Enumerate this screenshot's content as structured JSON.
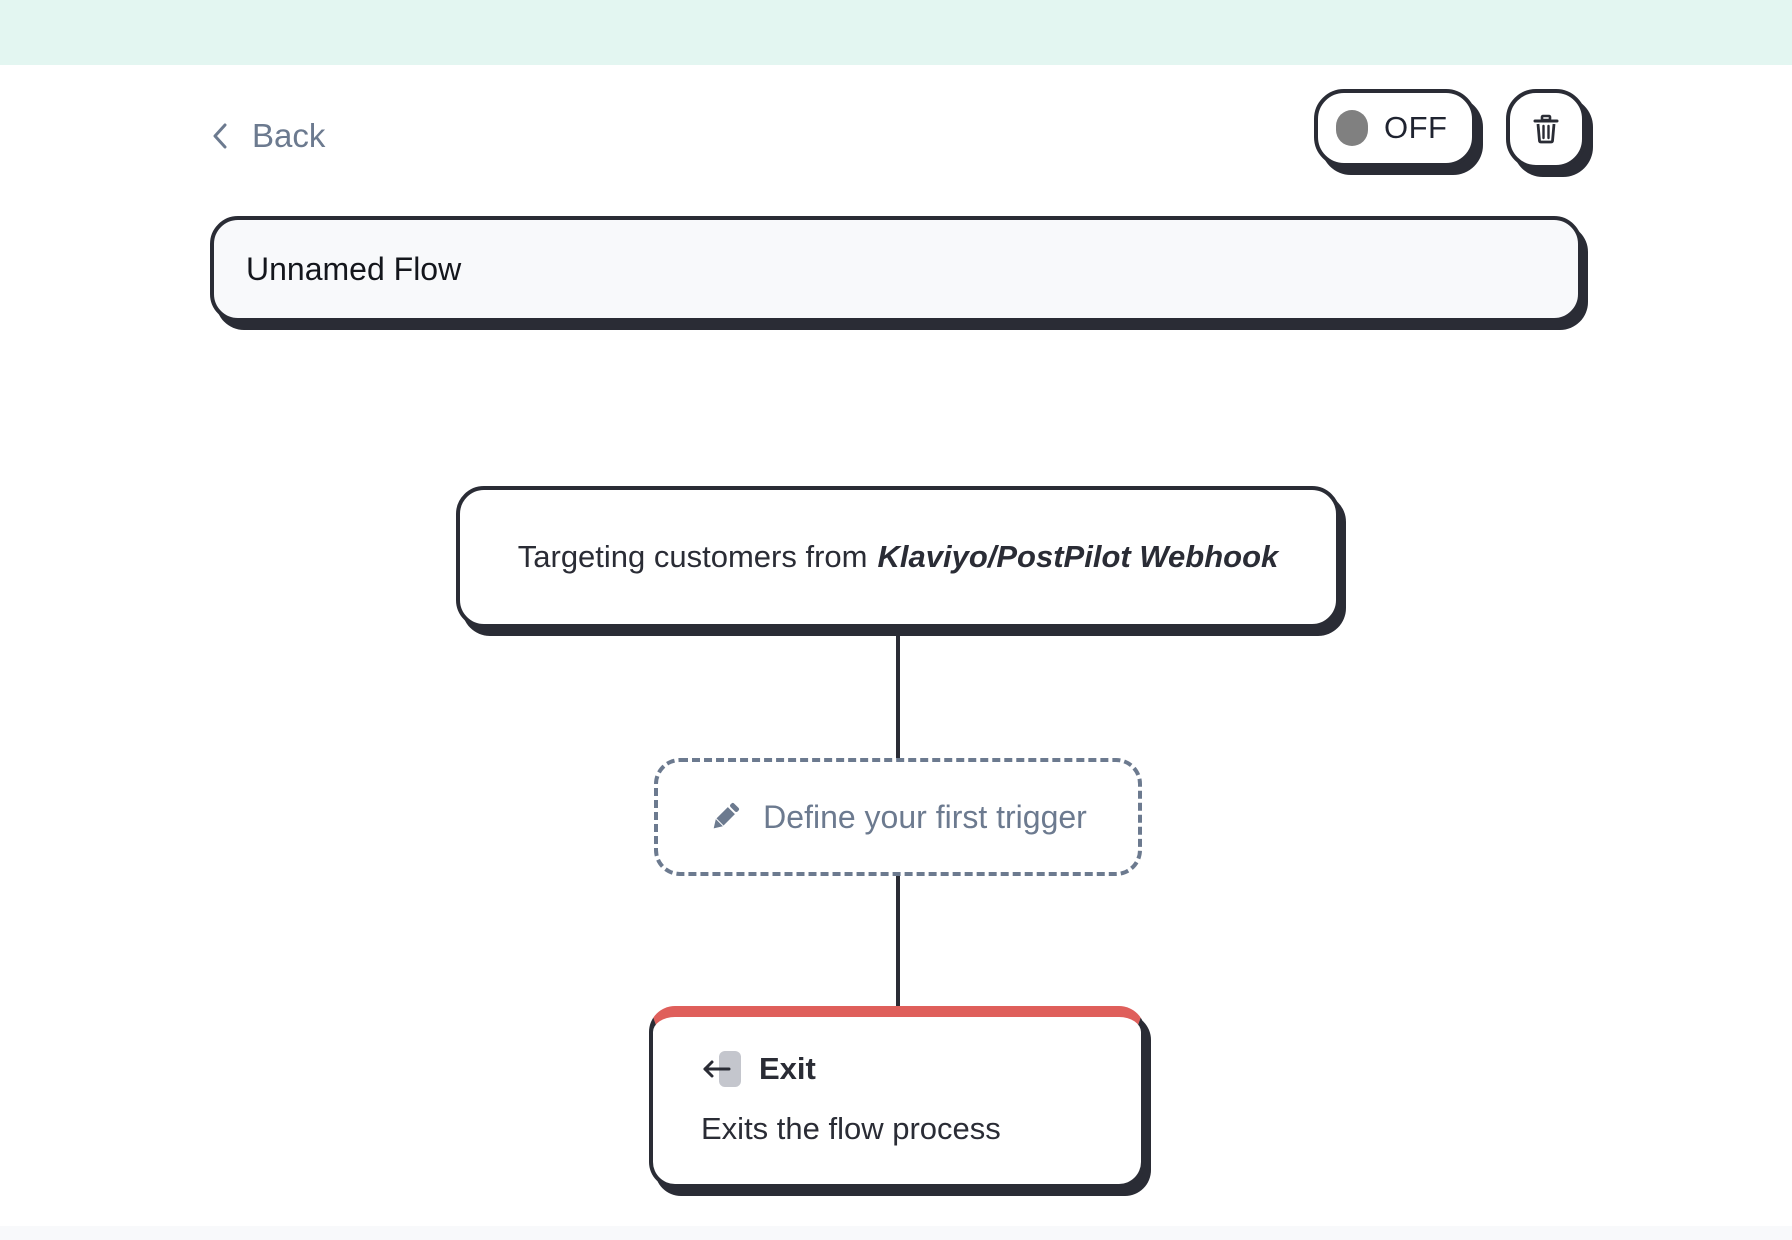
{
  "colors": {
    "banner": "#e3f6f1",
    "border": "#2a2c35",
    "muted_text": "#6c7a8f",
    "toggle_knob_off": "#808080",
    "exit_accent": "#df5f5b",
    "input_bg": "#f8f9fb"
  },
  "header": {
    "back": {
      "label": "Back",
      "icon": "chevron-left-icon"
    },
    "status_toggle": {
      "label": "OFF",
      "state": "off"
    },
    "delete_button": {
      "icon": "trash-icon"
    }
  },
  "flow_name": {
    "value": "Unnamed Flow"
  },
  "canvas": {
    "source_node": {
      "prefix": "Targeting customers from",
      "source_name": "Klaviyo/PostPilot Webhook"
    },
    "trigger_placeholder": {
      "label": "Define your first trigger",
      "icon": "pencil-icon"
    },
    "exit_node": {
      "title": "Exit",
      "description": "Exits the flow process",
      "icon": "exit-arrow-icon"
    }
  }
}
